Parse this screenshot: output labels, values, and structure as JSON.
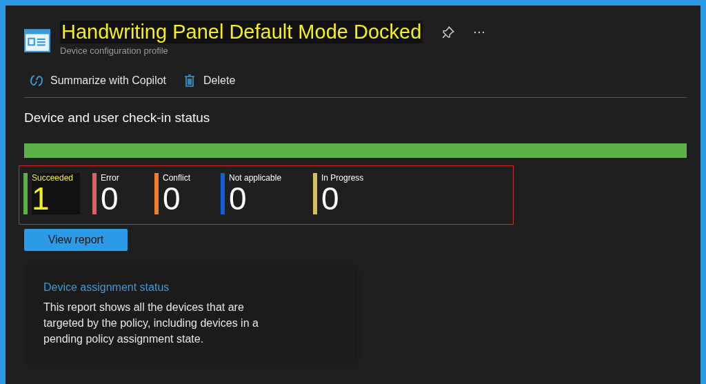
{
  "header": {
    "title": "Handwriting Panel Default Mode Docked",
    "title_highlighted": true,
    "subtitle": "Device configuration profile"
  },
  "toolbar": [
    "Summarize with Copilot",
    "Delete"
  ],
  "section": {
    "title": "Device and user check-in status",
    "level": 1
  },
  "statuses": [
    {
      "label": "Succeeded",
      "count": "1",
      "color": "#5db14a",
      "highlighted": true
    },
    {
      "label": "Error",
      "count": "0",
      "color": "#d9626b",
      "highlighted": false
    },
    {
      "label": "Conflict",
      "count": "0",
      "color": "#f07e2b",
      "highlighted": false
    },
    {
      "label": "Not applicable",
      "count": "0",
      "color": "#1160d8",
      "highlighted": false
    },
    {
      "label": "In Progress",
      "count": "0",
      "color": "#d8bd5c",
      "highlighted": false
    }
  ],
  "view_report": "View report",
  "card": {
    "title": "Device assignment status",
    "text": "This report shows all the devices that are targeted by the policy, including devices in a pending policy assignment state."
  }
}
